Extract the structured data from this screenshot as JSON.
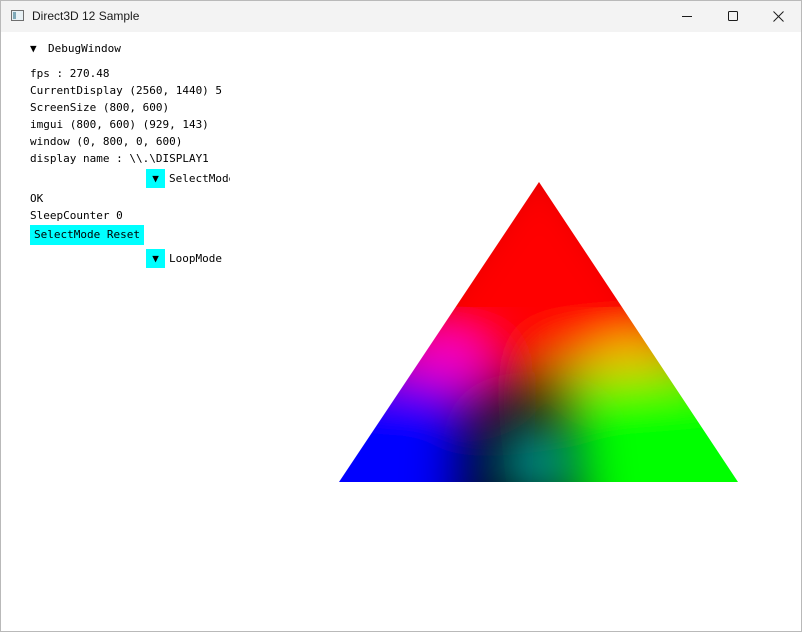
{
  "window": {
    "title": "Direct3D 12 Sample",
    "controls": {
      "minimize": "minimize",
      "maximize": "maximize",
      "close": "close"
    }
  },
  "debug_window": {
    "header_arrow": "▼",
    "header_title": "DebugWindow",
    "lines": [
      "fps :  270.48",
      "CurrentDisplay (2560, 1440) 5",
      "ScreenSize (800, 600)",
      "imgui (800, 600) (929, 143)",
      "window (0, 800, 0, 600)",
      "display name : \\\\.\\DISPLAY1"
    ],
    "select_mode_combo": {
      "arrow": "▼",
      "label": "SelectMode"
    },
    "status": "OK",
    "sleep_counter": "SleepCounter 0",
    "reset_button": "SelectMode Reset",
    "loop_mode_combo": {
      "arrow": "▼",
      "label": "LoopMode"
    }
  },
  "scene": {
    "vertex_colors": {
      "top": "#ff0000",
      "right": "#00ff00",
      "left": "#0000ff"
    }
  }
}
